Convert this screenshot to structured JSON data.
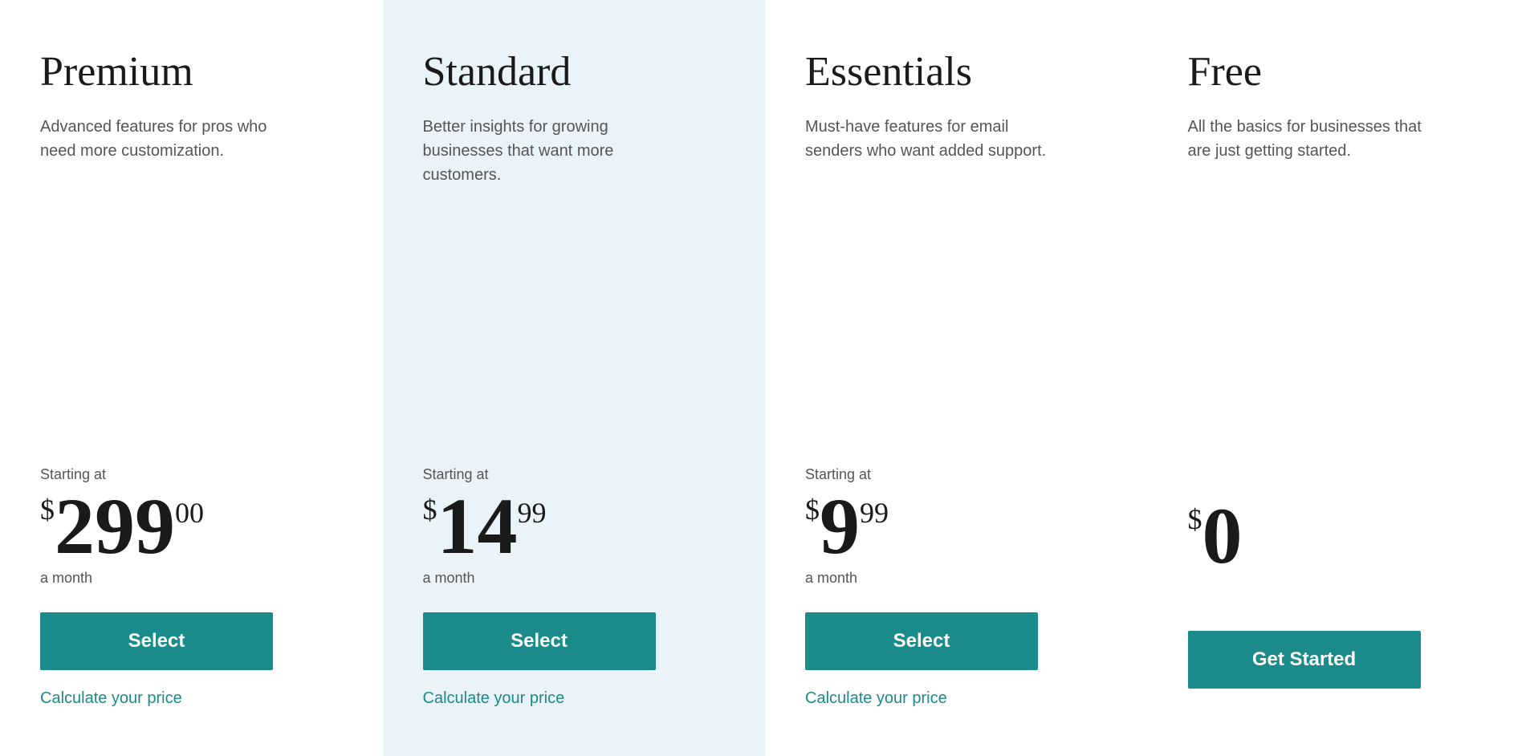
{
  "plans": [
    {
      "id": "premium",
      "name": "Premium",
      "description": "Advanced features for pros who need more customization.",
      "highlighted": false,
      "starting_at_label": "Starting at",
      "price_dollar": "$",
      "price_main": "299",
      "price_cents": "00",
      "price_period": "a month",
      "button_label": "Select",
      "calculate_label": "Calculate your price",
      "show_starting_at": true
    },
    {
      "id": "standard",
      "name": "Standard",
      "description": "Better insights for growing businesses that want more customers.",
      "highlighted": true,
      "starting_at_label": "Starting at",
      "price_dollar": "$",
      "price_main": "14",
      "price_cents": "99",
      "price_period": "a month",
      "button_label": "Select",
      "calculate_label": "Calculate your price",
      "show_starting_at": true
    },
    {
      "id": "essentials",
      "name": "Essentials",
      "description": "Must-have features for email senders who want added support.",
      "highlighted": false,
      "starting_at_label": "Starting at",
      "price_dollar": "$",
      "price_main": "9",
      "price_cents": "99",
      "price_period": "a month",
      "button_label": "Select",
      "calculate_label": "Calculate your price",
      "show_starting_at": true
    },
    {
      "id": "free",
      "name": "Free",
      "description": "All the basics for businesses that are just getting started.",
      "highlighted": false,
      "starting_at_label": "",
      "price_dollar": "$",
      "price_main": "0",
      "price_cents": "",
      "price_period": "",
      "button_label": "Get Started",
      "calculate_label": "",
      "show_starting_at": false
    }
  ]
}
